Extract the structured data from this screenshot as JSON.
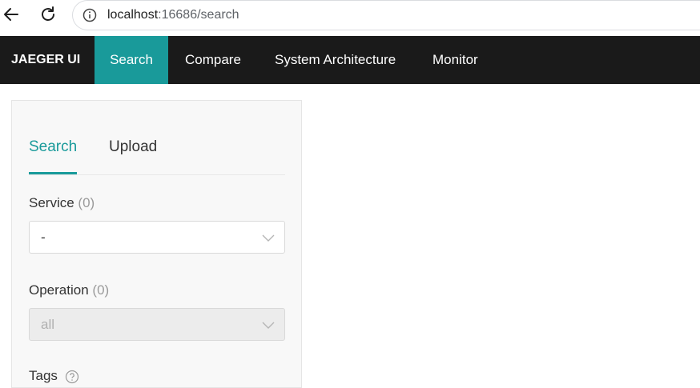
{
  "browser": {
    "url_host": "localhost",
    "url_rest": ":16686/search",
    "back_icon": "arrow-left-icon",
    "reload_icon": "reload-icon",
    "info_icon": "info-icon"
  },
  "topnav": {
    "brand": "JAEGER UI",
    "items": [
      {
        "label": "Search",
        "active": true
      },
      {
        "label": "Compare"
      },
      {
        "label": "System Architecture"
      },
      {
        "label": "Monitor"
      }
    ]
  },
  "colors": {
    "accent": "#199a9a",
    "nav_bg": "#1a1a1a"
  },
  "panel": {
    "tabs": [
      {
        "label": "Search",
        "active": true
      },
      {
        "label": "Upload"
      }
    ],
    "service": {
      "label": "Service",
      "count": "(0)",
      "value": "-"
    },
    "operation": {
      "label": "Operation",
      "count": "(0)",
      "value": "all",
      "disabled": true
    },
    "tags": {
      "label": "Tags"
    }
  }
}
